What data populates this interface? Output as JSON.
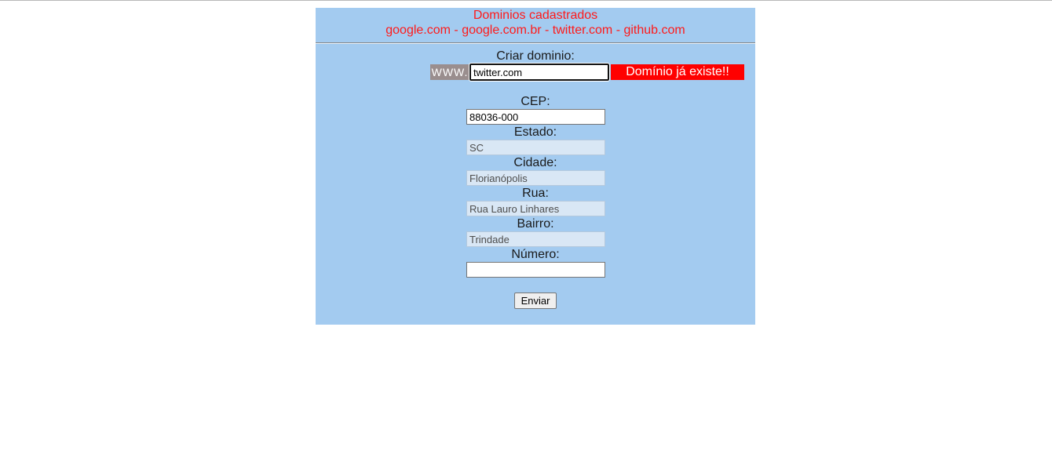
{
  "header": {
    "title": "Dominios cadastrados",
    "domains_list": "google.com - google.com.br - twitter.com - github.com"
  },
  "form": {
    "create_domain_label": "Criar dominio:",
    "www_prefix": "WWW.",
    "domain_value": "twitter.com",
    "error_message": "Domínio já existe!!",
    "cep_label": "CEP:",
    "cep_value": "88036-000",
    "estado_label": "Estado:",
    "estado_value": "SC",
    "cidade_label": "Cidade:",
    "cidade_value": "Florianópolis",
    "rua_label": "Rua:",
    "rua_value": "Rua Lauro Linhares",
    "bairro_label": "Bairro:",
    "bairro_value": "Trindade",
    "numero_label": "Número:",
    "numero_value": "",
    "submit_label": "Enviar"
  },
  "colors": {
    "panel_background": "#a3cbf0",
    "header_text": "#ff1a1a",
    "error_background": "#ff0000",
    "prefix_background": "#9a8e8e"
  }
}
